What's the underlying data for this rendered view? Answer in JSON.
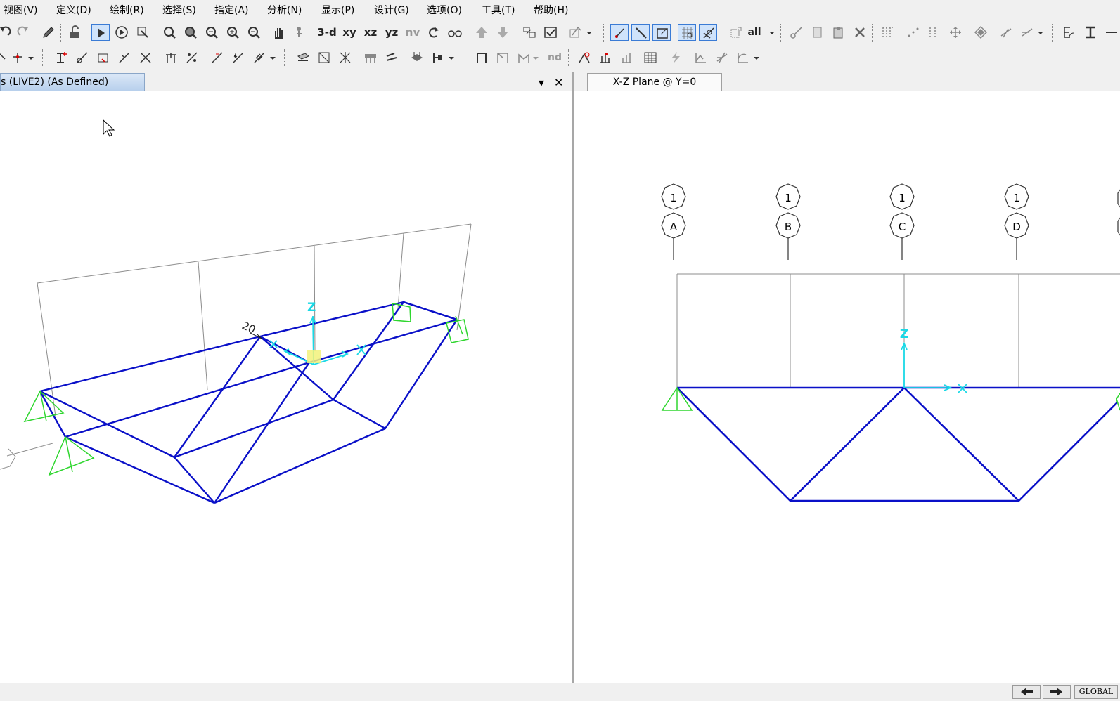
{
  "menubar": {
    "items": [
      "视图(V)",
      "定义(D)",
      "绘制(R)",
      "选择(S)",
      "指定(A)",
      "分析(N)",
      "显示(P)",
      "设计(G)",
      "选项(O)",
      "工具(T)",
      "帮助(H)"
    ]
  },
  "toolbar": {
    "view_3d": "3-d",
    "view_xy": "xy",
    "view_xz": "xz",
    "view_yz": "yz",
    "view_nv": "nv",
    "all_label": "all",
    "nd_label": "nd"
  },
  "left_window": {
    "tab_title": "s (LIVE2) (As Defined)",
    "angle_label": "20",
    "axis_z": "Z",
    "axis_x": "X"
  },
  "right_window": {
    "tab_title": "X-Z Plane @ Y=0",
    "axis_z": "Z",
    "axis_x": "X",
    "grid_bubbles": [
      {
        "top": "1",
        "bottom": "A"
      },
      {
        "top": "1",
        "bottom": "B"
      },
      {
        "top": "1",
        "bottom": "C"
      },
      {
        "top": "1",
        "bottom": "D"
      }
    ]
  },
  "status": {
    "coord_system": "GLOBAL"
  },
  "colors": {
    "frame": "#0a10c8",
    "support": "#2fd62f",
    "axis": "#19d9e6",
    "grid": "#8c8c8c"
  }
}
